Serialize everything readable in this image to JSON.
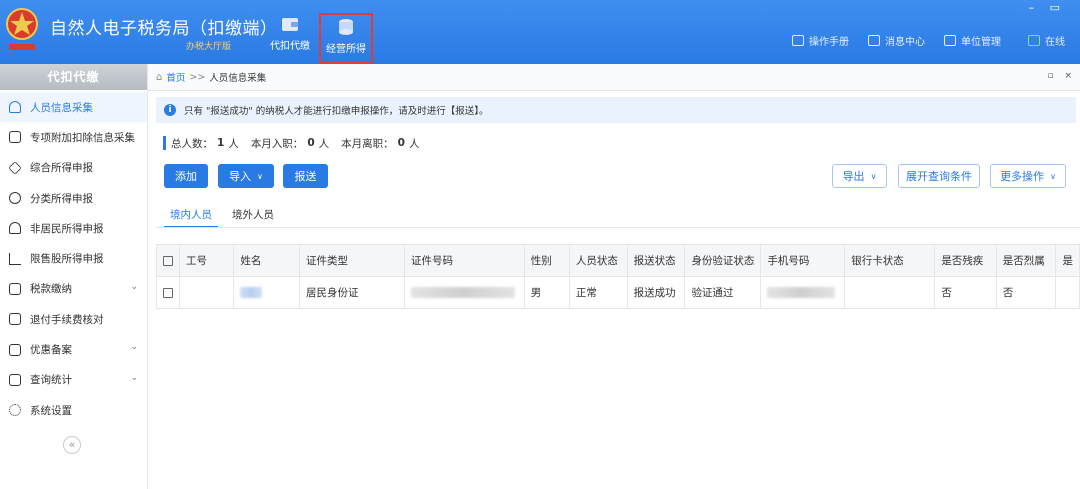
{
  "app": {
    "title": "自然人电子税务局（扣缴端）",
    "subtitle": "办税大厅版"
  },
  "nav": [
    {
      "label": "代扣代缴",
      "icon": "wallet-icon"
    },
    {
      "label": "经营所得",
      "icon": "coins-icon"
    }
  ],
  "header_menu": [
    {
      "label": "操作手册",
      "icon": "manual-icon"
    },
    {
      "label": "消息中心",
      "icon": "mail-icon"
    },
    {
      "label": "单位管理",
      "icon": "building-icon"
    },
    {
      "label": "在线",
      "icon": "online-check-icon"
    }
  ],
  "window_controls": "– ▭",
  "sidebar": {
    "heading": "代扣代缴",
    "items": [
      {
        "label": "人员信息采集",
        "icon": "person-icon",
        "active": true
      },
      {
        "label": "专项附加扣除信息采集",
        "icon": "list-icon"
      },
      {
        "label": "综合所得申报",
        "icon": "layers-icon"
      },
      {
        "label": "分类所得申报",
        "icon": "pie-icon"
      },
      {
        "label": "非居民所得申报",
        "icon": "person-outline-icon"
      },
      {
        "label": "限售股所得申报",
        "icon": "bar-chart-icon"
      },
      {
        "label": "税款缴纳",
        "icon": "folder-icon",
        "chevron": true
      },
      {
        "label": "退付手续费核对",
        "icon": "receipt-icon"
      },
      {
        "label": "优惠备案",
        "icon": "document-icon",
        "chevron": true
      },
      {
        "label": "查询统计",
        "icon": "search-list-icon",
        "chevron": true
      },
      {
        "label": "系统设置",
        "icon": "gear-icon"
      }
    ],
    "collapse": "«"
  },
  "breadcrumb": {
    "home": "首页",
    "sep": ">>",
    "current": "人员信息采集",
    "controls": "▫ ×"
  },
  "notice": "只有 \"报送成功\" 的纳税人才能进行扣缴申报操作，请及时进行【报送】。",
  "stats": {
    "total_label": "总人数：",
    "total": "1",
    "unit": "人",
    "hired_label": "本月入职：",
    "hired": "0",
    "left_label": "本月离职：",
    "left": "0"
  },
  "toolbar": {
    "add": "添加",
    "import": "导入",
    "submit": "报送",
    "export": "导出",
    "expand_query": "展开查询条件",
    "more": "更多操作"
  },
  "tabs": [
    "境内人员",
    "境外人员"
  ],
  "table": {
    "headers": [
      "工号",
      "姓名",
      "证件类型",
      "证件号码",
      "性别",
      "人员状态",
      "报送状态",
      "身份验证状态",
      "手机号码",
      "银行卡状态",
      "是否残疾",
      "是否烈属",
      "是"
    ],
    "rows": [
      [
        "",
        "",
        "居民身份证",
        "",
        "男",
        "正常",
        "报送成功",
        "验证通过",
        "",
        "",
        "否",
        "否",
        ""
      ]
    ]
  }
}
